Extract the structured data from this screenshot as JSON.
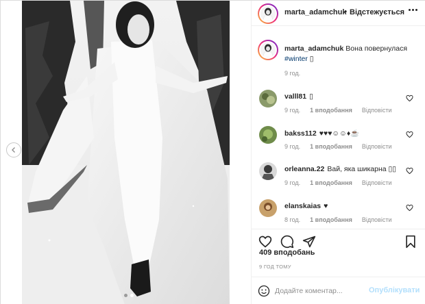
{
  "post": {
    "username": "marta_adamchuk",
    "separator": "•",
    "follow_label": "Відстежується"
  },
  "caption": {
    "username": "marta_adamchuk",
    "text": "Вона повернулася",
    "hashtag": "#winter",
    "emoji": "▯",
    "time": "9 год."
  },
  "comments": [
    {
      "username": "valll81",
      "text": "▯",
      "time": "9 год.",
      "likes": "1 вподобання",
      "reply": "Відповісти"
    },
    {
      "username": "bakss112",
      "text": "♥♥♥☺☺♦☕",
      "time": "9 год.",
      "likes": "1 вподобання",
      "reply": "Відповісти"
    },
    {
      "username": "orleanna.22",
      "text": "Вай, яка шикарна ▯▯",
      "time": "9 год.",
      "likes": "1 вподобання",
      "reply": "Відповісти"
    },
    {
      "username": "elanskaias",
      "text": "♥",
      "time": "8 год.",
      "likes": "1 вподобання",
      "reply": "Відповісти"
    }
  ],
  "likes_count": "409 вподобань",
  "time_ago": "9 ГОД ТОМУ",
  "add_comment": {
    "placeholder": "Додайте коментар...",
    "publish_label": "Опублікувати"
  },
  "colors": {
    "link_blue": "#00376b",
    "publish_disabled": "#b2dffc",
    "meta_gray": "#8e8e8e"
  },
  "icons": [
    "chevron-left-icon",
    "more-icon",
    "heart-icon",
    "comment-icon",
    "share-icon",
    "bookmark-icon",
    "emoji-icon"
  ],
  "carousel": {
    "total": 2,
    "active": 2
  }
}
